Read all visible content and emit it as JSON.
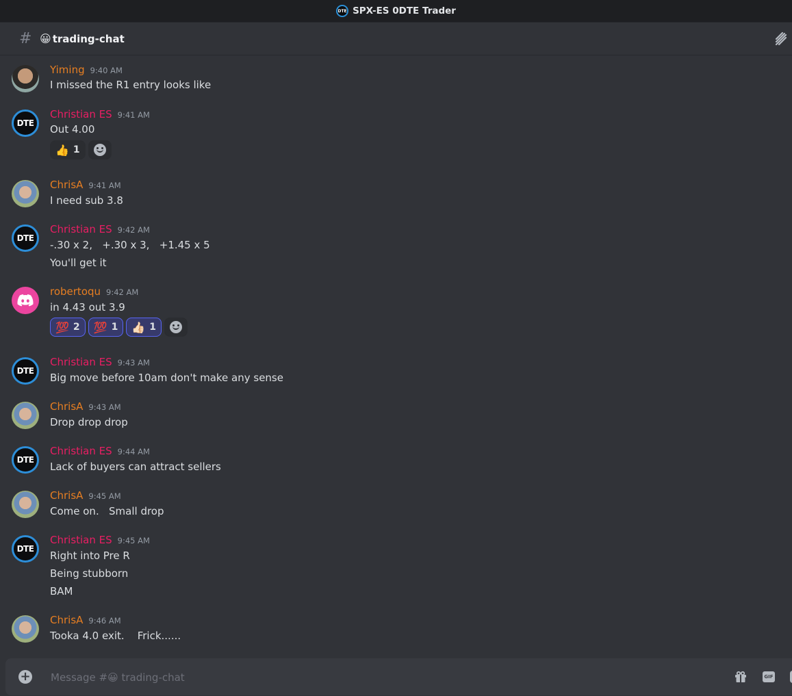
{
  "window": {
    "title": "SPX-ES 0DTE Trader",
    "server_logo_text": "DTE"
  },
  "channel": {
    "emoji": "😀",
    "name": "trading-chat"
  },
  "messages": [
    {
      "user": "Yiming",
      "color": "#e67e22",
      "avatar": "photo-yiming",
      "time": "9:40 AM",
      "lines": [
        "I missed the R1 entry looks like"
      ]
    },
    {
      "user": "Christian ES",
      "color": "#e91e63",
      "avatar": "dte-logo",
      "time": "9:41 AM",
      "lines": [
        "Out 4.00"
      ],
      "reactions": [
        {
          "emoji": "👍",
          "count": "1"
        }
      ]
    },
    {
      "user": "ChrisA",
      "color": "#e67e22",
      "avatar": "photo-chrisa",
      "time": "9:41 AM",
      "lines": [
        "I need sub 3.8"
      ]
    },
    {
      "user": "Christian ES",
      "color": "#e91e63",
      "avatar": "dte-logo",
      "time": "9:42 AM",
      "lines": [
        "-.30 x 2,   +.30 x 3,   +1.45 x 5",
        "You'll get it"
      ]
    },
    {
      "user": "robertoqu",
      "color": "#e67e22",
      "avatar": "discord-default",
      "time": "9:42 AM",
      "lines": [
        "in 4.43 out 3.9"
      ],
      "reactions": [
        {
          "emoji": "💯",
          "count": "2"
        },
        {
          "emoji": "💯",
          "count": "1"
        },
        {
          "emoji": "👍🏻",
          "count": "1"
        }
      ]
    },
    {
      "user": "Christian ES",
      "color": "#e91e63",
      "avatar": "dte-logo",
      "time": "9:43 AM",
      "lines": [
        "Big move before 10am don't make any sense"
      ]
    },
    {
      "user": "ChrisA",
      "color": "#e67e22",
      "avatar": "photo-chrisa",
      "time": "9:43 AM",
      "lines": [
        "Drop drop drop"
      ]
    },
    {
      "user": "Christian ES",
      "color": "#e91e63",
      "avatar": "dte-logo",
      "time": "9:44 AM",
      "lines": [
        "Lack of buyers can attract sellers"
      ]
    },
    {
      "user": "ChrisA",
      "color": "#e67e22",
      "avatar": "photo-chrisa",
      "time": "9:45 AM",
      "lines": [
        "Come on.   Small drop"
      ]
    },
    {
      "user": "Christian ES",
      "color": "#e91e63",
      "avatar": "dte-logo",
      "time": "9:45 AM",
      "lines": [
        "Right into Pre R",
        "Being stubborn",
        "BAM"
      ]
    },
    {
      "user": "ChrisA",
      "color": "#e67e22",
      "avatar": "photo-chrisa",
      "time": "9:46 AM",
      "lines": [
        "Tooka 4.0 exit.    Frick......"
      ]
    }
  ],
  "composer": {
    "placeholder": "Message #😀 trading-chat",
    "gif_label": "GIF"
  }
}
